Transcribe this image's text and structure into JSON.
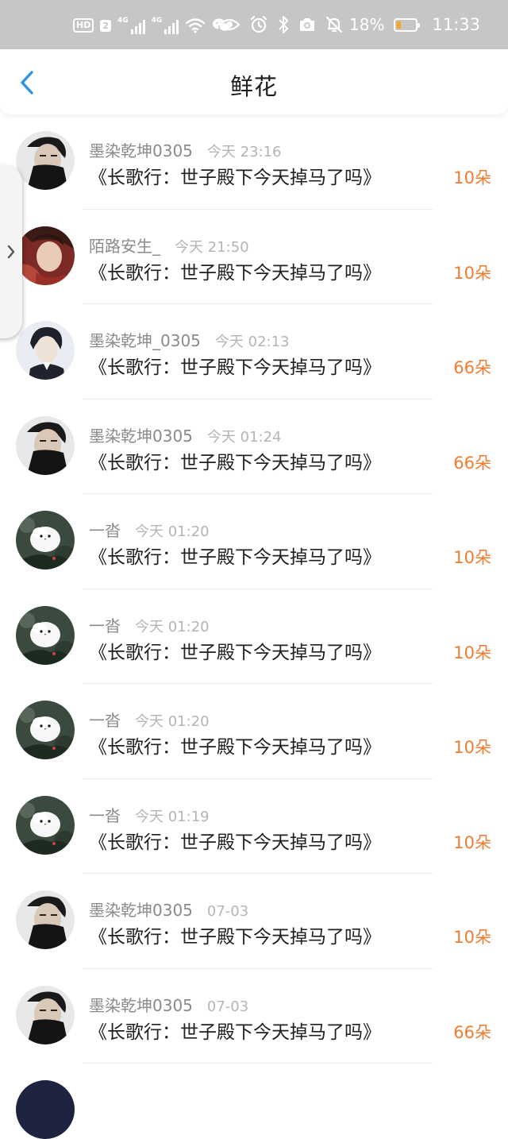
{
  "status_bar": {
    "left_badges": {
      "hd": "HD",
      "sim": "2",
      "net1": "4G",
      "net2": "4G"
    },
    "battery_percent": "18%",
    "battery_level": 0.18,
    "time": "11:33",
    "icons": [
      "eye-icon",
      "alarm-icon",
      "bluetooth-icon",
      "camera-icon",
      "mute-icon"
    ]
  },
  "header": {
    "title": "鲜花",
    "back_icon": "chevron-left-icon"
  },
  "colors": {
    "accent": "#2f95e6",
    "flower_count": "#f07c32"
  },
  "records": [
    {
      "user": "墨染乾坤0305",
      "time": "今天 23:16",
      "book": "《长歌行：世子殿下今天掉马了吗》",
      "count": "10朵",
      "avatar": "dark-portrait"
    },
    {
      "user": "陌路安生_",
      "time": "今天 21:50",
      "book": "《长歌行：世子殿下今天掉马了吗》",
      "count": "10朵",
      "avatar": "red-portrait"
    },
    {
      "user": "墨染乾坤_0305",
      "time": "今天 02:13",
      "book": "《长歌行：世子殿下今天掉马了吗》",
      "count": "66朵",
      "avatar": "light-portrait"
    },
    {
      "user": "墨染乾坤0305",
      "time": "今天 01:24",
      "book": "《长歌行：世子殿下今天掉马了吗》",
      "count": "66朵",
      "avatar": "dark-portrait"
    },
    {
      "user": "一沓",
      "time": "今天 01:20",
      "book": "《长歌行：世子殿下今天掉马了吗》",
      "count": "10朵",
      "avatar": "white-bird"
    },
    {
      "user": "一沓",
      "time": "今天 01:20",
      "book": "《长歌行：世子殿下今天掉马了吗》",
      "count": "10朵",
      "avatar": "white-bird"
    },
    {
      "user": "一沓",
      "time": "今天 01:20",
      "book": "《长歌行：世子殿下今天掉马了吗》",
      "count": "10朵",
      "avatar": "white-bird"
    },
    {
      "user": "一沓",
      "time": "今天 01:19",
      "book": "《长歌行：世子殿下今天掉马了吗》",
      "count": "10朵",
      "avatar": "white-bird"
    },
    {
      "user": "墨染乾坤0305",
      "time": "07-03",
      "book": "《长歌行：世子殿下今天掉马了吗》",
      "count": "10朵",
      "avatar": "dark-portrait"
    },
    {
      "user": "墨染乾坤0305",
      "time": "07-03",
      "book": "《长歌行：世子殿下今天掉马了吗》",
      "count": "66朵",
      "avatar": "dark-portrait"
    }
  ],
  "side_tab": {
    "icon": "chevron-right-icon"
  }
}
